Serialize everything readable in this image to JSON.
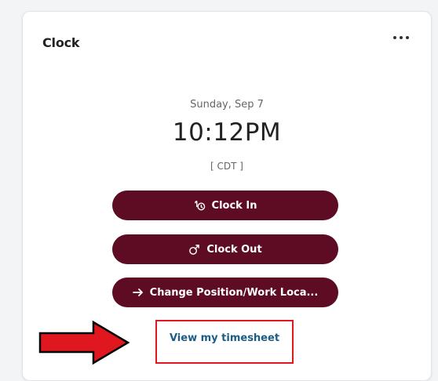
{
  "card": {
    "title": "Clock",
    "more_label": "..."
  },
  "clock": {
    "date": "Sunday, Sep 7",
    "time": "10:12PM",
    "timezone": "[ CDT ]"
  },
  "actions": [
    {
      "label": "Clock In",
      "icon": "hand-pointer-clock-icon"
    },
    {
      "label": "Clock Out",
      "icon": "exit-arrow-icon"
    },
    {
      "label": "Change Position/Work Loca...",
      "icon": "arrow-right-icon"
    }
  ],
  "link": {
    "timesheet": "View my timesheet"
  },
  "colors": {
    "button_bg": "#5d0c23",
    "link": "#1b5d86",
    "annotation": "#e0171e"
  }
}
